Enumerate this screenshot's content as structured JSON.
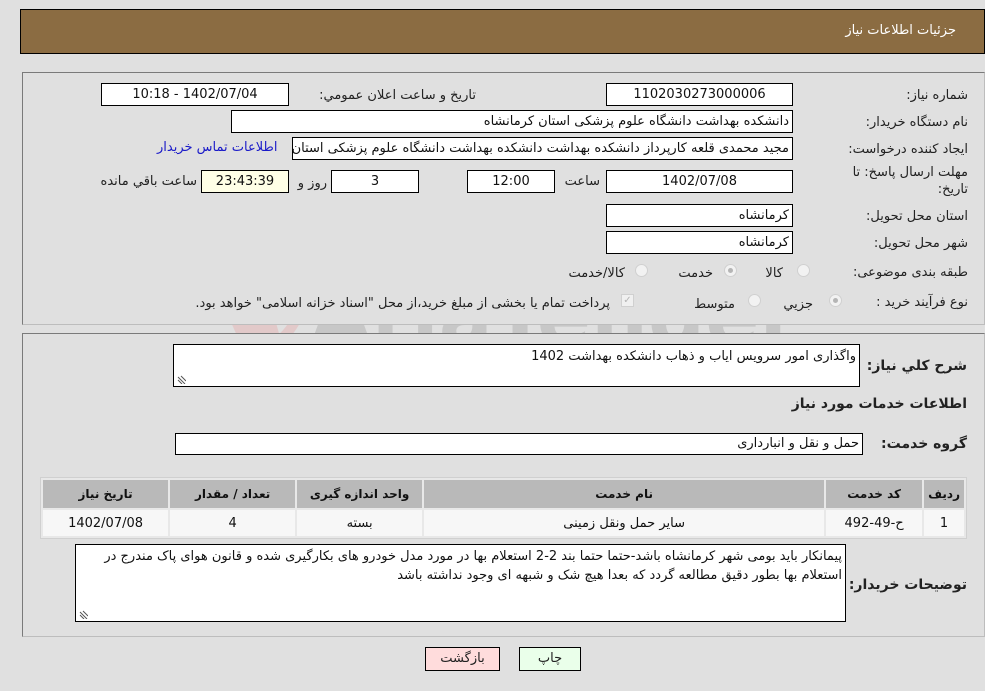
{
  "header": {
    "title": "جزئیات اطلاعات نیاز"
  },
  "form": {
    "need_number": {
      "label": "شماره نیاز:",
      "value": "1102030273000006"
    },
    "announce_datetime": {
      "label": "تاریخ و ساعت اعلان عمومي:",
      "value": "1402/07/04 - 10:18"
    },
    "buyer_org": {
      "label": "نام دستگاه خریدار:",
      "value": "دانشکده بهداشت دانشگاه علوم پزشکی استان کرمانشاه"
    },
    "requester": {
      "label": "ایجاد کننده درخواست:",
      "value": "مجید محمدی قلعه کارپرداز دانشکده بهداشت دانشکده بهداشت دانشگاه علوم پزشکی استان کرمانشاه"
    },
    "buyer_contact_link": "اطلاعات تماس خریدار",
    "deadline": {
      "label_line1": "مهلت ارسال پاسخ: تا",
      "label_line2": "تاریخ:",
      "date": "1402/07/08",
      "time_label": "ساعت",
      "time": "12:00",
      "days": "3",
      "days_label": "روز و",
      "remaining": "23:43:39",
      "remaining_label": "ساعت باقي مانده"
    },
    "delivery_province": {
      "label": "استان محل تحویل:",
      "value": "کرمانشاه"
    },
    "delivery_city": {
      "label": "شهر محل تحویل:",
      "value": "کرمانشاه"
    },
    "category": {
      "label": "طبقه بندی موضوعی:",
      "options": [
        {
          "label": "کالا",
          "checked": false
        },
        {
          "label": "خدمت",
          "checked": true
        },
        {
          "label": "کالا/خدمت",
          "checked": false
        }
      ]
    },
    "purchase_process": {
      "label": "نوع فرآیند خرید :",
      "options": [
        {
          "label": "جزيي",
          "checked": true
        },
        {
          "label": "متوسط",
          "checked": false
        }
      ],
      "treasury_note": "پرداخت تمام یا بخشی از مبلغ خرید،از محل \"اسناد خزانه اسلامی\" خواهد بود.",
      "treasury_checked": true
    }
  },
  "details": {
    "general_desc_label": "شرح كلي نياز:",
    "general_desc": "واگذاری امور سرویس ایاب و ذهاب دانشکده بهداشت 1402",
    "services_heading": "اطلاعات خدمات مورد نیاز",
    "service_group_label": "گروه خدمت:",
    "service_group": "حمل و نقل و انبارداری",
    "table": {
      "headers": [
        "ردیف",
        "کد خدمت",
        "نام خدمت",
        "واحد اندازه گیری",
        "تعداد / مقدار",
        "تاریخ نیاز"
      ],
      "rows": [
        [
          "1",
          "ح-49-492",
          "سایر حمل ونقل زمینی",
          "بسته",
          "4",
          "1402/07/08"
        ]
      ]
    },
    "buyer_notes_label": "توضیحات خریدار:",
    "buyer_notes": "پیمانکار باید بومی شهر کرمانشاه باشد-حتما حتما بند 2-2 استعلام بها در مورد مدل خودرو های بکارگیری شده و قانون هوای پاک مندرج در استعلام بها بطور دقیق مطالعه گردد که بعدا هیچ شک و شبهه ای وجود نداشته باشد"
  },
  "buttons": {
    "print": "چاپ",
    "back": "بازگشت"
  },
  "watermark": {
    "text": "AriaTender.neT"
  },
  "colors": {
    "header_bg": "#8b6c42",
    "link": "#1a1ac8",
    "back_bg": "#ffdcdc",
    "print_bg": "#eaffea",
    "remaining_bg": "#ffffe6"
  }
}
